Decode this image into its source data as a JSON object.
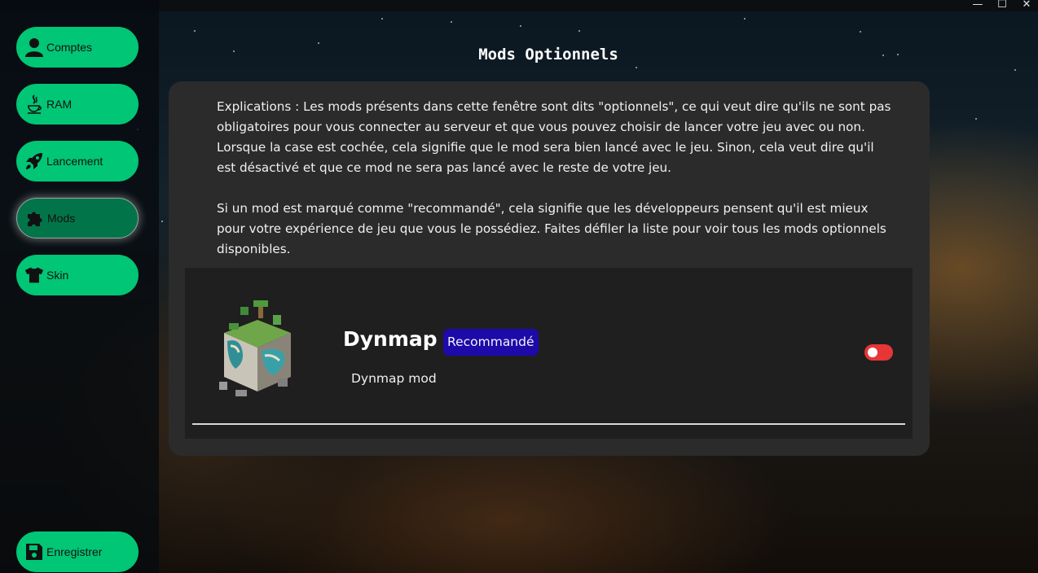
{
  "window": {
    "controls": {
      "minimize": "—",
      "maximize": "☐",
      "close": "✕"
    }
  },
  "sidebar": {
    "items": [
      {
        "label": "Comptes",
        "icon": "user-icon",
        "active": false
      },
      {
        "label": "RAM",
        "icon": "java-icon",
        "active": false
      },
      {
        "label": "Lancement",
        "icon": "rocket-icon",
        "active": false
      },
      {
        "label": "Mods",
        "icon": "puzzle-icon",
        "active": true
      },
      {
        "label": "Skin",
        "icon": "tshirt-icon",
        "active": false
      }
    ],
    "save_label": "Enregistrer",
    "save_icon": "floppy-disk-icon"
  },
  "page": {
    "title": "Mods Optionnels",
    "explanation": [
      "Explications : Les mods présents dans cette fenêtre sont dits \"optionnels\", ce qui veut dire qu'ils ne sont pas obligatoires pour vous connecter au serveur et que vous pouvez choisir de lancer votre jeu avec ou non. Lorsque la case est cochée, cela signifie que le mod sera bien lancé avec le jeu. Sinon, cela veut dire qu'il est désactivé et que ce mod ne sera pas lancé avec le reste de votre jeu.",
      "Si un mod est marqué comme \"recommandé\", cela signifie que les développeurs pensent qu'il est mieux pour votre expérience de jeu que vous le possédiez. Faites défiler la liste pour voir tous les mods optionnels disponibles."
    ]
  },
  "mods": [
    {
      "name": "Dynmap",
      "badge": "Recommandé",
      "description": "Dynmap mod",
      "enabled": false
    }
  ],
  "colors": {
    "accent": "#00c676",
    "accent_active": "#02744a",
    "badge": "#1d0aa8",
    "toggle_off": "#e63636",
    "panel": "#2b2b2b",
    "card": "#1f1f1f"
  }
}
